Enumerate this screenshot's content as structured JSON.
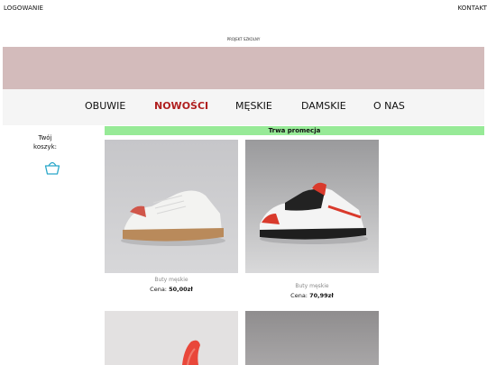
{
  "header": {
    "login_label": "LOGOWANIE",
    "contact_label": "KONTAKT",
    "subtitle": "PROJEKT SZKOLNY"
  },
  "nav": {
    "items": [
      {
        "label": "OBUWIE"
      },
      {
        "label": "NOWOŚCI"
      },
      {
        "label": "MĘSKIE"
      },
      {
        "label": "DAMSKIE"
      },
      {
        "label": "O NAS"
      }
    ],
    "active_index": 1
  },
  "cart": {
    "label_line1": "Twój",
    "label_line2": "koszyk:",
    "icon": "shopping-basket-icon"
  },
  "promo": {
    "text": "Trwa promecja"
  },
  "products": [
    {
      "category": "Buty męskie",
      "price_prefix": "Cena:",
      "price": "50,00zł"
    },
    {
      "category": "Buty męskie",
      "price_prefix": "Cena:",
      "price": "70,99zł"
    }
  ],
  "colors": {
    "banner": "#d3bbbb",
    "nav_bg": "#f5f5f5",
    "active_nav": "#b01f1f",
    "promo_bg": "#97ea97",
    "cart_icon": "#2aa7c9"
  }
}
